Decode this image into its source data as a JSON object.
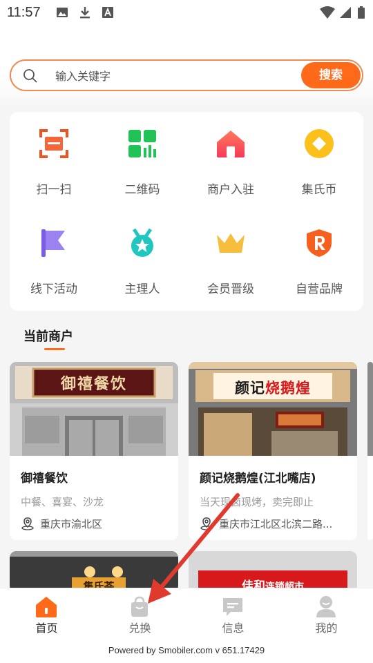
{
  "status_bar": {
    "time": "11:57"
  },
  "search": {
    "placeholder": "输入关键字",
    "button_label": "搜索"
  },
  "grid": {
    "items": [
      {
        "label": "扫一扫",
        "icon": "scan-icon"
      },
      {
        "label": "二维码",
        "icon": "qrcode-icon"
      },
      {
        "label": "商户入驻",
        "icon": "store-icon"
      },
      {
        "label": "集氏币",
        "icon": "coin-icon"
      },
      {
        "label": "线下活动",
        "icon": "flag-icon"
      },
      {
        "label": "主理人",
        "icon": "medal-icon"
      },
      {
        "label": "会员晋级",
        "icon": "crown-icon"
      },
      {
        "label": "自营品牌",
        "icon": "brand-icon"
      }
    ]
  },
  "section": {
    "title": "当前商户"
  },
  "shops": [
    {
      "name": "御禧餐饮",
      "tags": "中餐、喜宴、沙龙",
      "address": "重庆市渝北区",
      "sign": "御禧餐饮"
    },
    {
      "name": "颜记烧鹅煌(江北嘴店)",
      "tags": "当天现卤现烤，卖完即止",
      "address": "重庆市江北区北滨二路...",
      "sign_a": "颜记",
      "sign_b": "烧鹅煌"
    },
    {
      "sign": "集氏荟"
    },
    {
      "sign_a": "佳和",
      "sign_b": "连锁超市"
    }
  ],
  "tabs": [
    {
      "label": "首页",
      "icon": "home-icon",
      "active": true
    },
    {
      "label": "兑换",
      "icon": "bag-icon"
    },
    {
      "label": "信息",
      "icon": "message-icon"
    },
    {
      "label": "我的",
      "icon": "user-icon"
    }
  ],
  "footer": {
    "text": "Powered by Smobiler.com v 651.17429"
  },
  "colors": {
    "accent": "#ff6a1a",
    "annotation_arrow": "#e03a2f"
  }
}
